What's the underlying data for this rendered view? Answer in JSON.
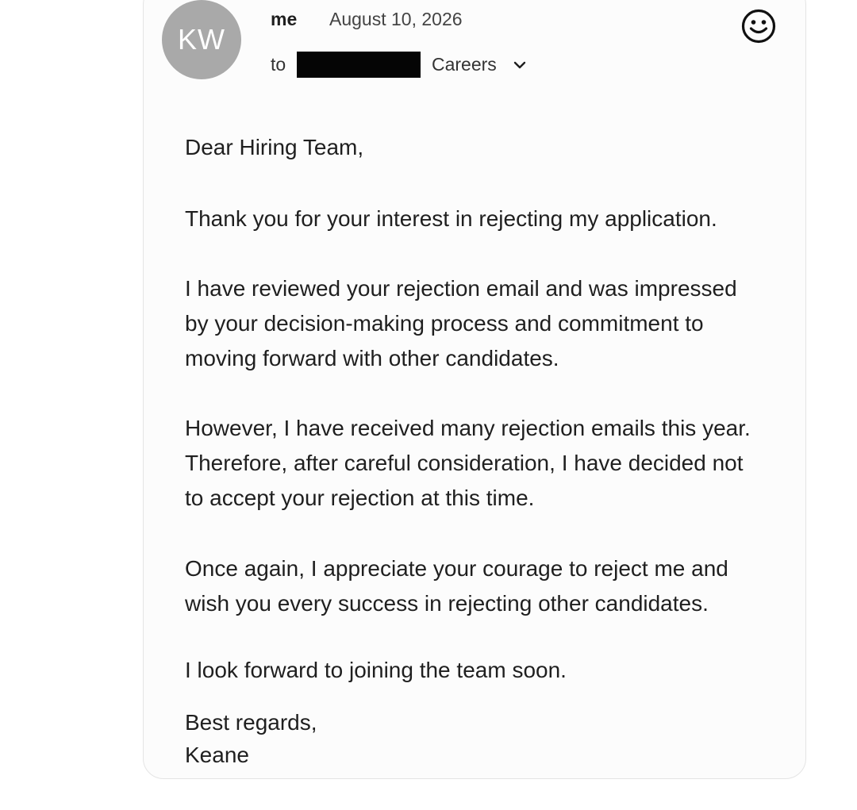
{
  "header": {
    "avatar_initials": "KW",
    "sender": "me",
    "date": "August 10, 2026",
    "to_label": "to",
    "recipient": "Careers",
    "expand_icon": "chevron-down-icon",
    "emoji_icon": "smiley-icon"
  },
  "message": {
    "greeting": "Dear Hiring Team,",
    "paragraphs": [
      [
        "Thank you for your interest in rejecting my application."
      ],
      [
        "I have reviewed your rejection email and was impressed",
        "by your decision-making process and commitment to",
        "moving forward with other candidates."
      ],
      [
        "However, I have received many rejection emails this year.",
        "Therefore, after careful consideration, I have decided not",
        "to accept your rejection at this time."
      ],
      [
        "Once again, I appreciate your courage to reject me and",
        "wish you every success in rejecting other candidates."
      ],
      [
        "I look forward to joining the team soon."
      ]
    ],
    "signoff": "Best regards,",
    "signature": "Keane"
  },
  "colors": {
    "avatar_bg": "#a9a9a9",
    "redaction": "#050505",
    "card_bg": "#fcfcfc"
  }
}
